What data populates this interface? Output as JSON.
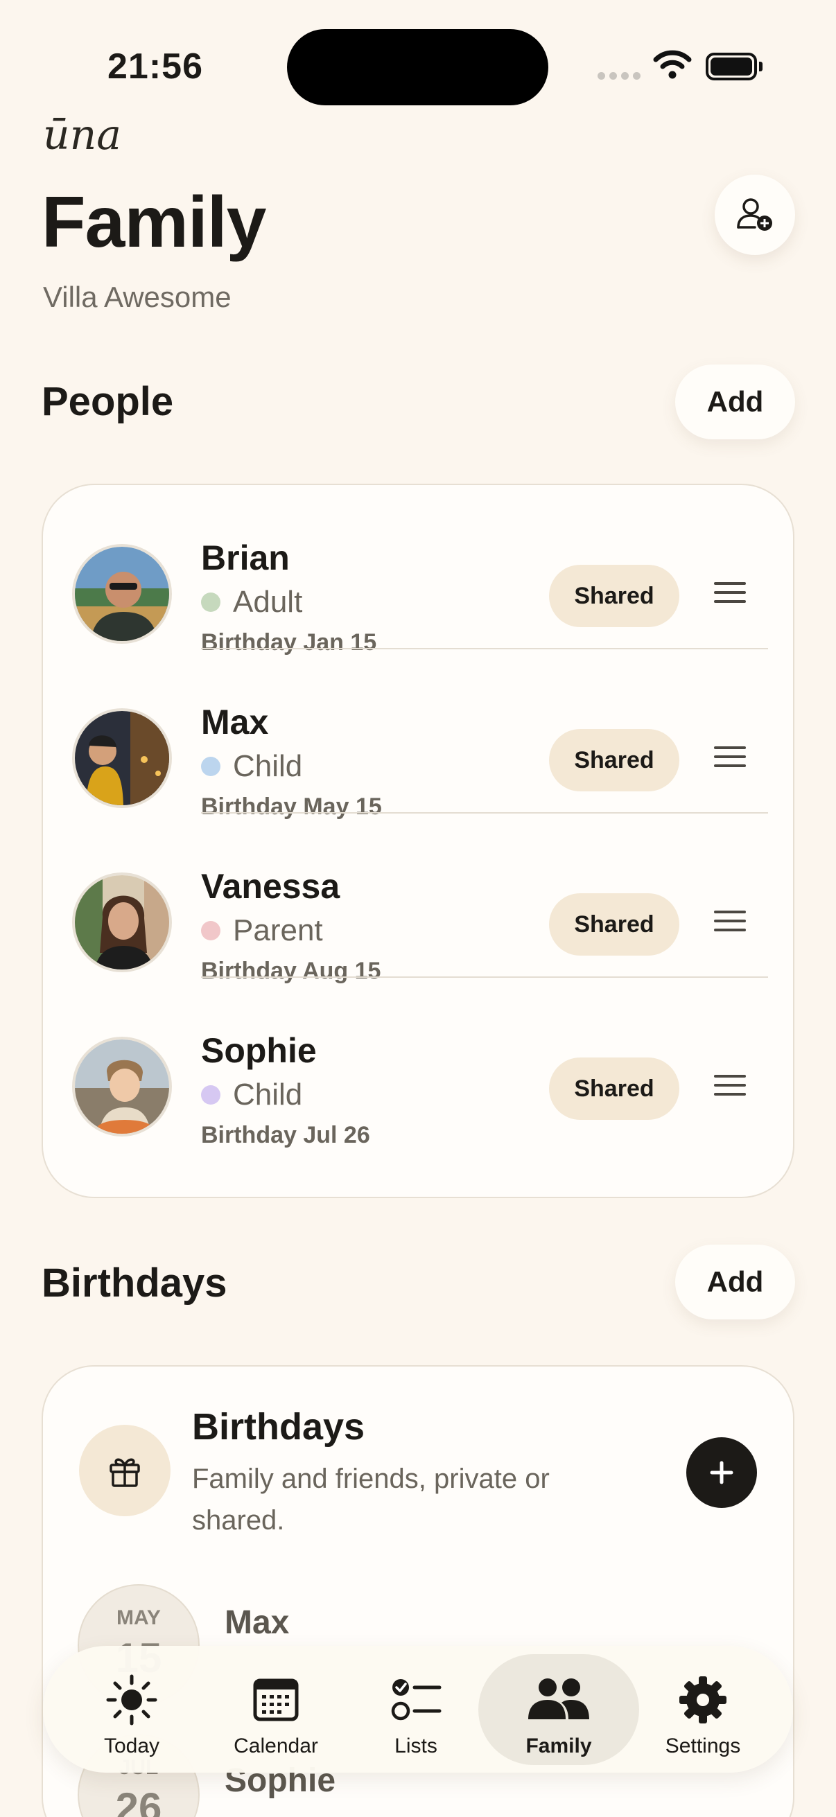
{
  "status": {
    "time": "21:56"
  },
  "header": {
    "brand": "ūna",
    "title": "Family",
    "subtitle": "Villa Awesome"
  },
  "people": {
    "title": "People",
    "add_label": "Add",
    "members": [
      {
        "name": "Brian",
        "role": "Adult",
        "role_color": "#c6d9bd",
        "birthday": "Birthday Jan 15",
        "badge": "Shared"
      },
      {
        "name": "Max",
        "role": "Child",
        "role_color": "#bcd5ee",
        "birthday": "Birthday May 15",
        "badge": "Shared"
      },
      {
        "name": "Vanessa",
        "role": "Parent",
        "role_color": "#f1c7c9",
        "birthday": "Birthday Aug 15",
        "badge": "Shared"
      },
      {
        "name": "Sophie",
        "role": "Child",
        "role_color": "#d6c8f2",
        "birthday": "Birthday Jul 26",
        "badge": "Shared"
      }
    ]
  },
  "birthdays": {
    "title": "Birthdays",
    "add_label": "Add",
    "card_title": "Birthdays",
    "card_desc": "Family and friends, private or shared.",
    "items": [
      {
        "month": "MAY",
        "day": "15",
        "name": "Max",
        "sub": ""
      },
      {
        "month": "JUL",
        "day": "26",
        "name": "Sophie",
        "sub": ""
      }
    ]
  },
  "tabs": [
    {
      "label": "Today",
      "icon": "sun-icon"
    },
    {
      "label": "Calendar",
      "icon": "calendar-icon"
    },
    {
      "label": "Lists",
      "icon": "list-icon"
    },
    {
      "label": "Family",
      "icon": "people-icon",
      "active": true
    },
    {
      "label": "Settings",
      "icon": "gear-icon"
    }
  ]
}
